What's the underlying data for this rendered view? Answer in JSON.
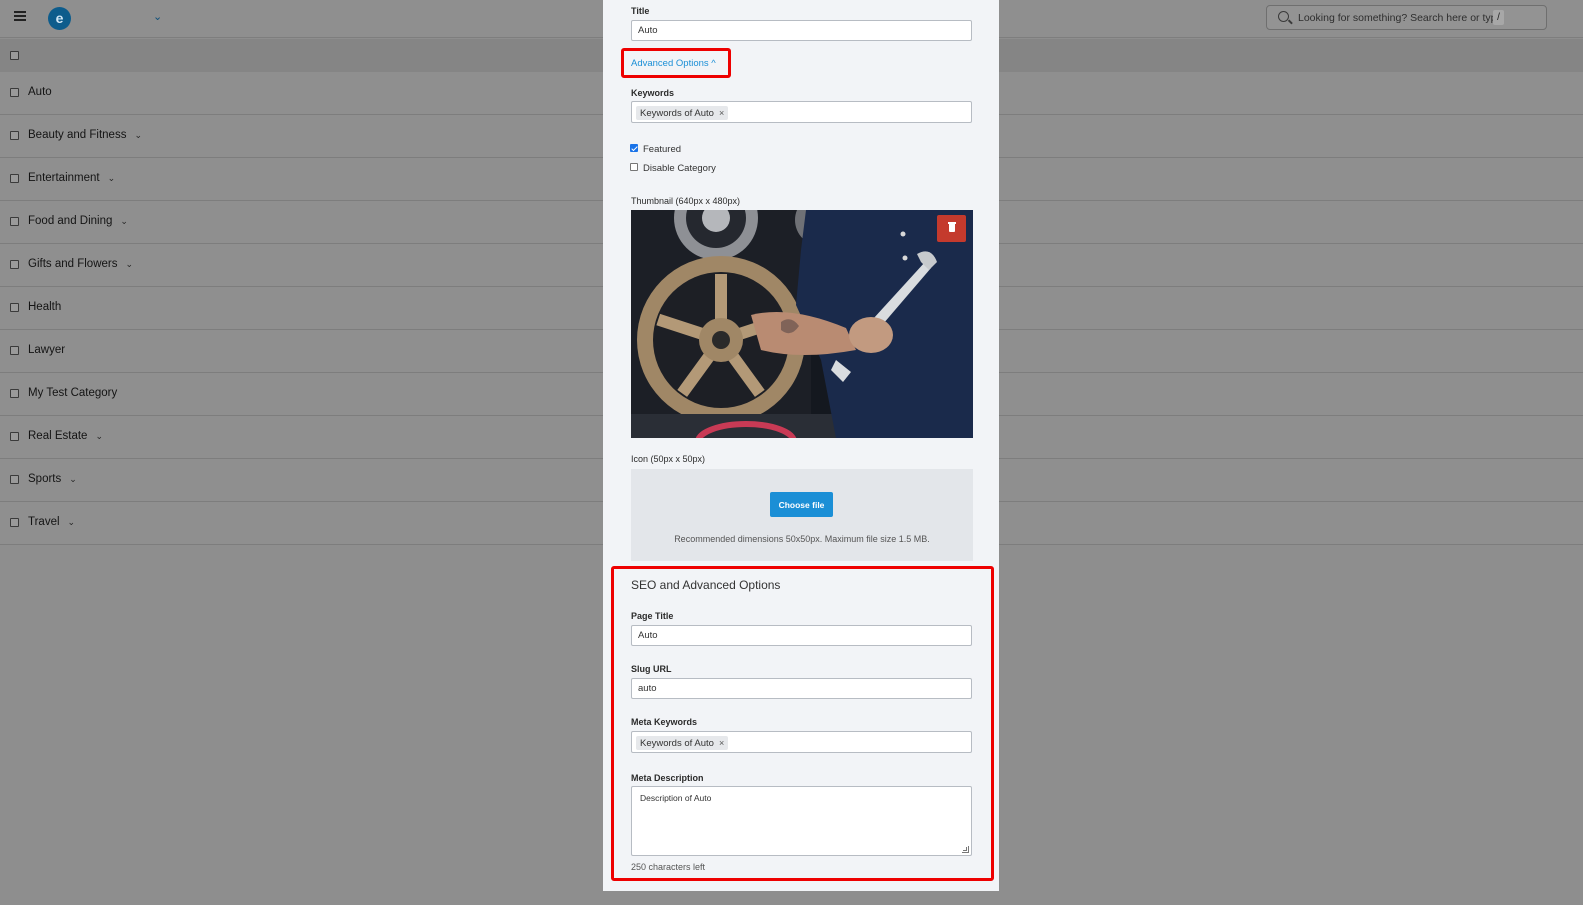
{
  "header": {
    "logo_letter": "e",
    "search_placeholder": "Looking for something? Search here or type",
    "search_shortcut": "/"
  },
  "categories": [
    {
      "label": "Auto",
      "has_children": false
    },
    {
      "label": "Beauty and Fitness",
      "has_children": true
    },
    {
      "label": "Entertainment",
      "has_children": true
    },
    {
      "label": "Food and Dining",
      "has_children": true
    },
    {
      "label": "Gifts and Flowers",
      "has_children": true
    },
    {
      "label": "Health",
      "has_children": false
    },
    {
      "label": "Lawyer",
      "has_children": false
    },
    {
      "label": "My Test Category",
      "has_children": false
    },
    {
      "label": "Real Estate",
      "has_children": true
    },
    {
      "label": "Sports",
      "has_children": true
    },
    {
      "label": "Travel",
      "has_children": true
    }
  ],
  "form": {
    "title_label": "Title",
    "title_value": "Auto",
    "advanced_toggle": "Advanced Options ^",
    "keywords_label": "Keywords",
    "keywords_tag": "Keywords of Auto",
    "tag_remove": "×",
    "featured_label": "Featured",
    "featured_checked": true,
    "disable_label": "Disable Category",
    "disable_checked": false,
    "thumbnail_label": "Thumbnail (640px x 480px)",
    "icon_label": "Icon (50px x 50px)",
    "choose_file": "Choose file",
    "icon_hint": "Recommended dimensions 50x50px. Maximum file size 1.5 MB."
  },
  "seo": {
    "heading": "SEO and Advanced Options",
    "page_title_label": "Page Title",
    "page_title_value": "Auto",
    "slug_label": "Slug URL",
    "slug_value": "auto",
    "meta_keywords_label": "Meta Keywords",
    "meta_keywords_tag": "Keywords of Auto",
    "meta_description_label": "Meta Description",
    "meta_description_value": "Description of Auto",
    "chars_left": "250 characters left"
  },
  "colors": {
    "accent": "#1b8fd6",
    "highlight": "#ee0000",
    "delete": "#c43a2d",
    "overlay": "#8f8f8f"
  }
}
